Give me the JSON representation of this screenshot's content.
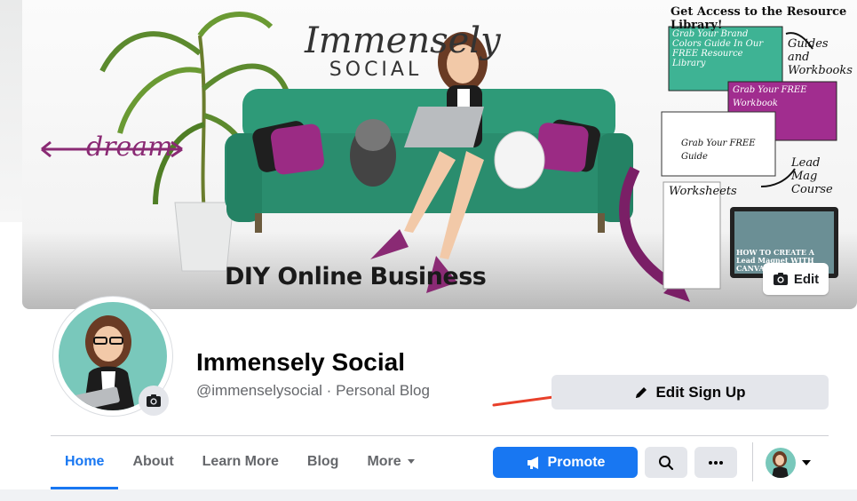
{
  "cover": {
    "edit_label": "Edit",
    "logo_line1": "Immensely",
    "logo_line2": "SOCIAL",
    "dream_text": "dream",
    "tagline": "DIY Online Business",
    "resource_headline": "Get Access to the Resource Library!",
    "notes": {
      "guides": "Guides and Workbooks",
      "lead_mag": "Lead Mag Course",
      "worksheets": "Worksheets"
    },
    "thumbs": {
      "brand_colors": "Grab Your Brand Colors Guide In Our FREE Resource Library",
      "free_workbook": "Grab Your FREE Workbook",
      "free_guide": "Grab Your FREE Guide",
      "how_to_create": "HOW TO CREATE A Lead Magnet WITH CANVA"
    }
  },
  "profile": {
    "name": "Immensely Social",
    "subtitle": "@immenselysocial · Personal Blog",
    "edit_signup_label": "Edit Sign Up"
  },
  "nav": {
    "tabs": [
      "Home",
      "About",
      "Learn More",
      "Blog",
      "More"
    ],
    "active_tab": "Home",
    "promote_label": "Promote"
  },
  "colors": {
    "accent": "#1877f2",
    "sofa": "#2e9a78",
    "magenta": "#8a2a74",
    "annotation_arrow": "#e8402a"
  },
  "icons": [
    "camera-icon",
    "pencil-icon",
    "megaphone-icon",
    "search-icon",
    "ellipsis-icon",
    "caret-down-icon"
  ]
}
